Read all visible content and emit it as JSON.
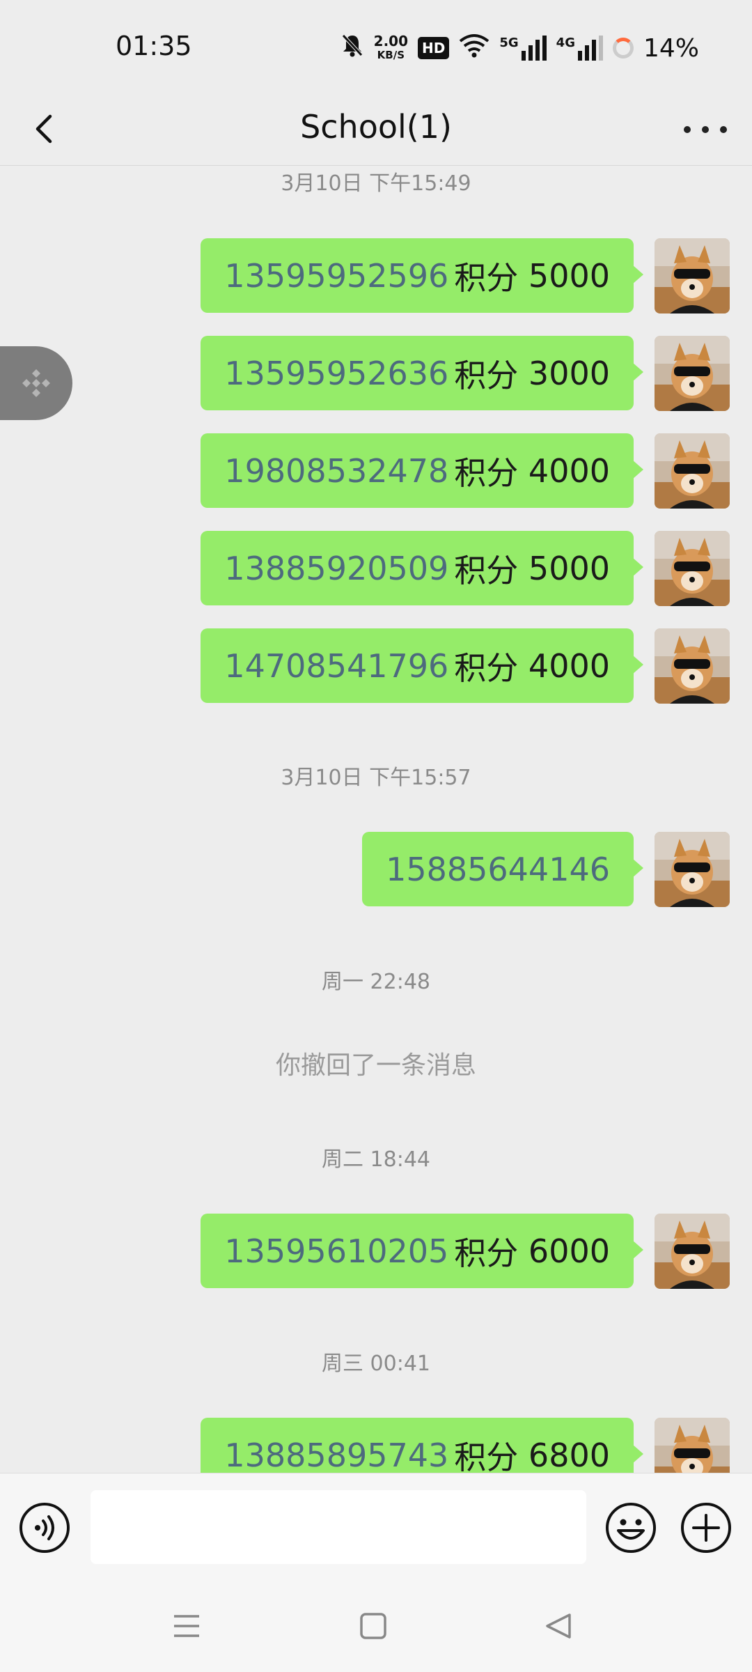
{
  "status_bar": {
    "time": "01:35",
    "speed_value": "2.00",
    "speed_unit": "KB/S",
    "hd_badge": "HD",
    "net_5g": "5G",
    "net_4g": "4G",
    "battery": "14%"
  },
  "header": {
    "title": "School(1)"
  },
  "chat": {
    "groups": [
      {
        "timestamp": "3月10日 下午15:49",
        "messages": [
          {
            "phone": "13595952596",
            "label": "积分",
            "points": "5000"
          },
          {
            "phone": "13595952636",
            "label": "积分",
            "points": "3000"
          },
          {
            "phone": "19808532478",
            "label": "积分",
            "points": "4000"
          },
          {
            "phone": "13885920509",
            "label": "积分",
            "points": "5000"
          },
          {
            "phone": "14708541796",
            "label": "积分",
            "points": "4000"
          }
        ]
      },
      {
        "timestamp": "3月10日 下午15:57",
        "messages": [
          {
            "phone": "15885644146"
          }
        ]
      },
      {
        "timestamp": "周一 22:48",
        "recall_notice": "你撤回了一条消息"
      },
      {
        "timestamp": "周二 18:44",
        "messages": [
          {
            "phone": "13595610205",
            "label": "积分",
            "points": "6000"
          }
        ]
      },
      {
        "timestamp": "周三 00:41",
        "messages": [
          {
            "phone": "13885895743",
            "label": "积分",
            "points": "6800"
          }
        ]
      }
    ]
  },
  "input_bar": {
    "value": "",
    "icons": [
      "voice-icon",
      "emoji-icon",
      "plus-icon"
    ]
  },
  "nav_bar": {
    "icons": [
      "menu-icon",
      "home-icon",
      "back-icon"
    ]
  },
  "colors": {
    "background": "#ededed",
    "bubble": "#95ec69",
    "phone_link": "#4d6a7e",
    "timestamp": "#8a8a8a"
  }
}
